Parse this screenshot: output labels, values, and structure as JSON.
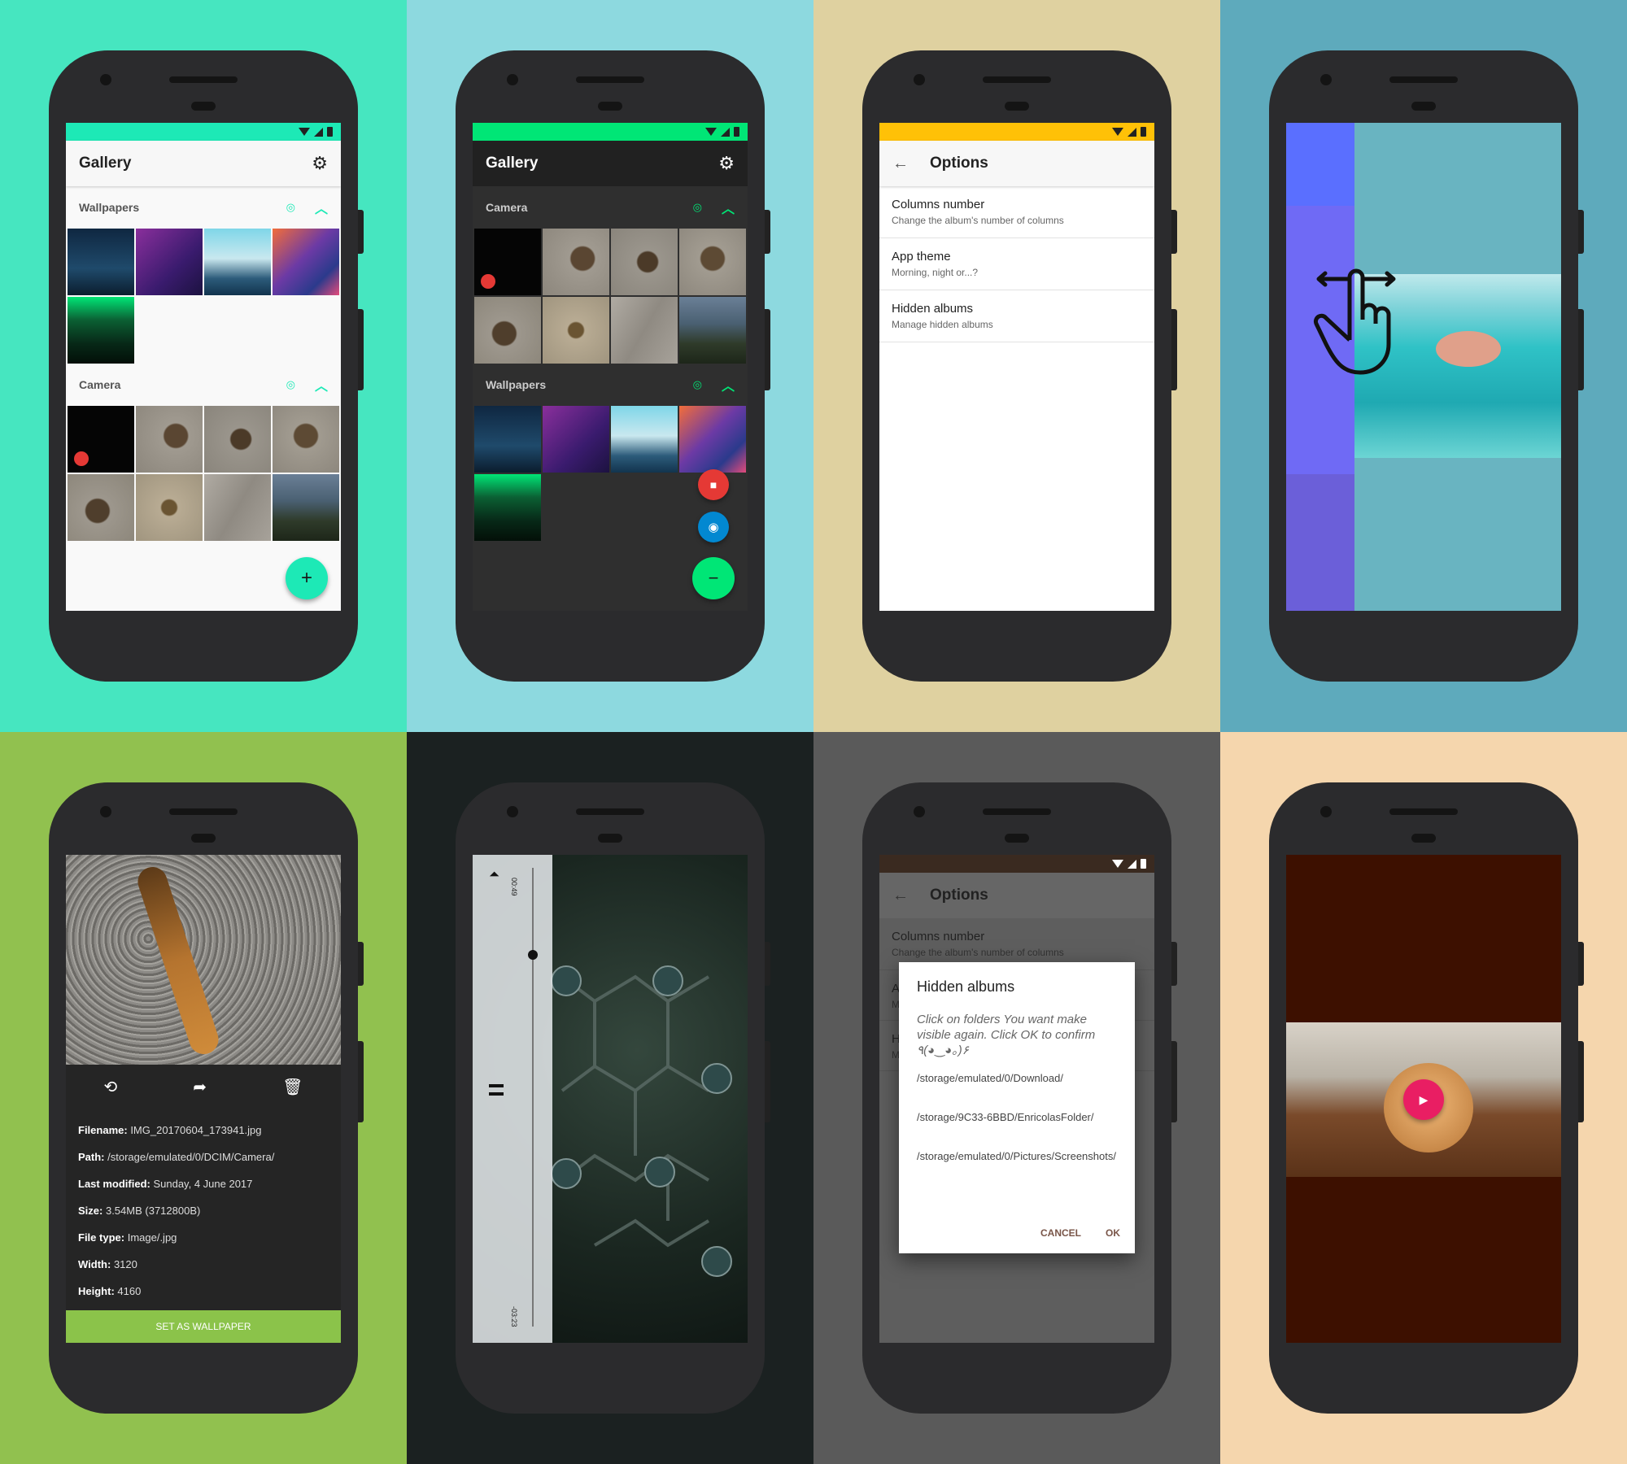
{
  "gallery": {
    "title": "Gallery",
    "sections": [
      {
        "name": "Wallpapers"
      },
      {
        "name": "Camera"
      }
    ]
  },
  "gallery_dark": {
    "title": "Gallery",
    "sections": [
      {
        "name": "Camera"
      },
      {
        "name": "Wallpapers"
      }
    ]
  },
  "options": {
    "title": "Options",
    "items": [
      {
        "title": "Columns number",
        "subtitle": "Change the album's number of columns"
      },
      {
        "title": "App theme",
        "subtitle": "Morning, night or...?"
      },
      {
        "title": "Hidden albums",
        "subtitle": "Manage hidden albums"
      }
    ]
  },
  "details": {
    "rows": [
      {
        "label": "Filename:",
        "value": "IMG_20170604_173941.jpg"
      },
      {
        "label": "Path:",
        "value": "/storage/emulated/0/DCIM/Camera/"
      },
      {
        "label": "Last modified:",
        "value": "Sunday, 4 June 2017"
      },
      {
        "label": "Size:",
        "value": "3.54MB  (3712800B)"
      },
      {
        "label": "File type:",
        "value": "Image/.jpg"
      },
      {
        "label": "Width:",
        "value": "3120"
      },
      {
        "label": "Height:",
        "value": "4160"
      }
    ],
    "set_wallpaper": "SET AS WALLPAPER"
  },
  "player": {
    "elapsed": "00:49",
    "remaining": "-03:23",
    "progress": 0.19
  },
  "dialog": {
    "options_title": "Options",
    "bg_title": "Columns number",
    "bg_subtitle": "Change the album's number of columns",
    "bg_item2": "A",
    "bg_item2_sub": "M",
    "bg_item3": "H",
    "bg_item3_sub": "M",
    "title": "Hidden albums",
    "message": "Click on folders You want make visible again. Click OK to confirm ٩(◕‿◕｡)۶",
    "folders": [
      "/storage/emulated/0/Download/",
      "/storage/9C33-6BBD/EnricolasFolder/",
      "/storage/emulated/0/Pictures/Screenshots/"
    ],
    "cancel": "CANCEL",
    "ok": "OK"
  },
  "colors": {
    "bg1": "#46e6c0",
    "bg2": "#8dd9df",
    "bg3": "#dfd1a0",
    "bg4": "#5eaabc",
    "bg5": "#91c14f",
    "bg6": "#1b2121",
    "bg7": "#5a5a5a",
    "bg8": "#f5d6ad",
    "accent_green": "#1de9b6",
    "dialog_accent": "#795548"
  },
  "icons": [
    "settings-icon",
    "hide-icon",
    "chevron-up-icon",
    "plus-icon",
    "minus-icon",
    "videocam-icon",
    "camera-icon",
    "back-arrow-icon",
    "swipe-hand-icon",
    "crop-rotate-icon",
    "share-icon",
    "delete-icon",
    "play-icon",
    "skip-icon",
    "pause-icon"
  ]
}
